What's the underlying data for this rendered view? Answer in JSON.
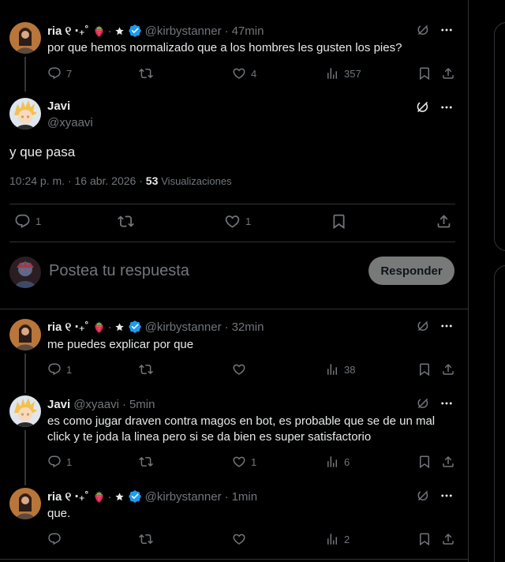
{
  "thread": [
    {
      "display_name": "ria ୧ ‧₊˚",
      "handle": "@kirbystanner",
      "time": "47min",
      "text": "por que hemos normalizado que a los hombres les gusten los pies?",
      "replies": "7",
      "reposts": "",
      "likes": "4",
      "views": "357"
    }
  ],
  "focused": {
    "display_name": "Javi",
    "handle": "@xyaavi",
    "text": "y que pasa",
    "timestamp": "10:24 p. m. · 16 abr. 2026 ·",
    "views_count": "53",
    "views_label": "Visualizaciones",
    "replies": "1",
    "reposts": "",
    "likes": "1"
  },
  "reply_box": {
    "placeholder": "Postea tu respuesta",
    "button_label": "Responder"
  },
  "replies": [
    {
      "display_name": "ria ୧ ‧₊˚",
      "handle": "@kirbystanner",
      "time": "32min",
      "text": "me puedes explicar por que",
      "replies": "1",
      "reposts": "",
      "likes": "",
      "views": "38"
    },
    {
      "display_name": "Javi",
      "handle": "@xyaavi",
      "time": "5min",
      "text": "es como jugar draven contra magos en bot, es probable que se de un mal click y te joda la linea pero si se da bien es super satisfactorio",
      "replies": "1",
      "reposts": "",
      "likes": "1",
      "views": "6"
    },
    {
      "display_name": "ria ୧ ‧₊˚",
      "handle": "@kirbystanner",
      "time": "1min",
      "text": "que.",
      "replies": "",
      "reposts": "",
      "likes": "",
      "views": "2"
    }
  ],
  "icons": {
    "reply": "reply-icon",
    "repost": "repost-icon",
    "like": "heart-icon",
    "views": "views-icon",
    "bookmark": "bookmark-icon",
    "share": "share-icon",
    "grok": "grok-icon",
    "more": "more-icon",
    "verified": "verified-badge-icon",
    "strawberry": "strawberry-emoji-icon",
    "star": "star-icon"
  },
  "colors": {
    "background": "#000000",
    "text_primary": "#e7e9ea",
    "text_secondary": "#71767b",
    "border": "#2f3336",
    "verified": "#1d9bf0",
    "reply_button": "#787a7a"
  }
}
